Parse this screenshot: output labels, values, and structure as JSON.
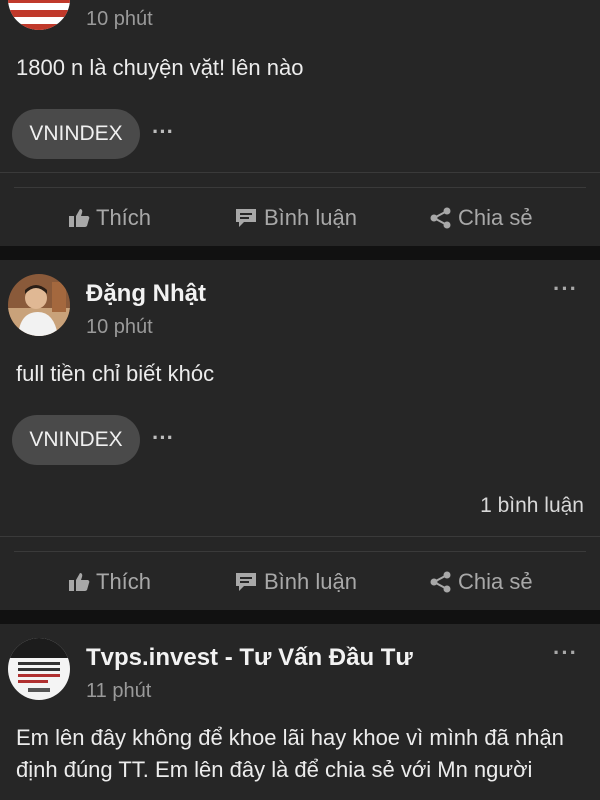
{
  "posts": [
    {
      "time": "10 phút",
      "content": "1800 n là chuyện vặt! lên nào",
      "tag": "VNINDEX",
      "actions": {
        "like": "Thích",
        "comment": "Bình luận",
        "share": "Chia sẻ"
      }
    },
    {
      "author": "Đặng Nhật",
      "time": "10 phút",
      "content": "full tiền chỉ biết khóc",
      "tag": "VNINDEX",
      "comment_count": "1 bình luận",
      "actions": {
        "like": "Thích",
        "comment": "Bình luận",
        "share": "Chia sẻ"
      }
    },
    {
      "author": "Tvps.invest - Tư Vấn Đầu Tư",
      "time": "11 phút",
      "content": "Em lên đây không để khoe lãi hay khoe vì mình đã nhận định đúng TT. Em lên đây là để chia sẻ với Mn người"
    }
  ],
  "icons": {
    "more": "more-horizontal-icon",
    "like": "thumbs-up-icon",
    "comment": "comment-icon",
    "share": "share-icon"
  },
  "colors": {
    "background": "#111111",
    "card": "#262626",
    "tag": "#4a4a4a",
    "muted": "#a8a8a8"
  }
}
